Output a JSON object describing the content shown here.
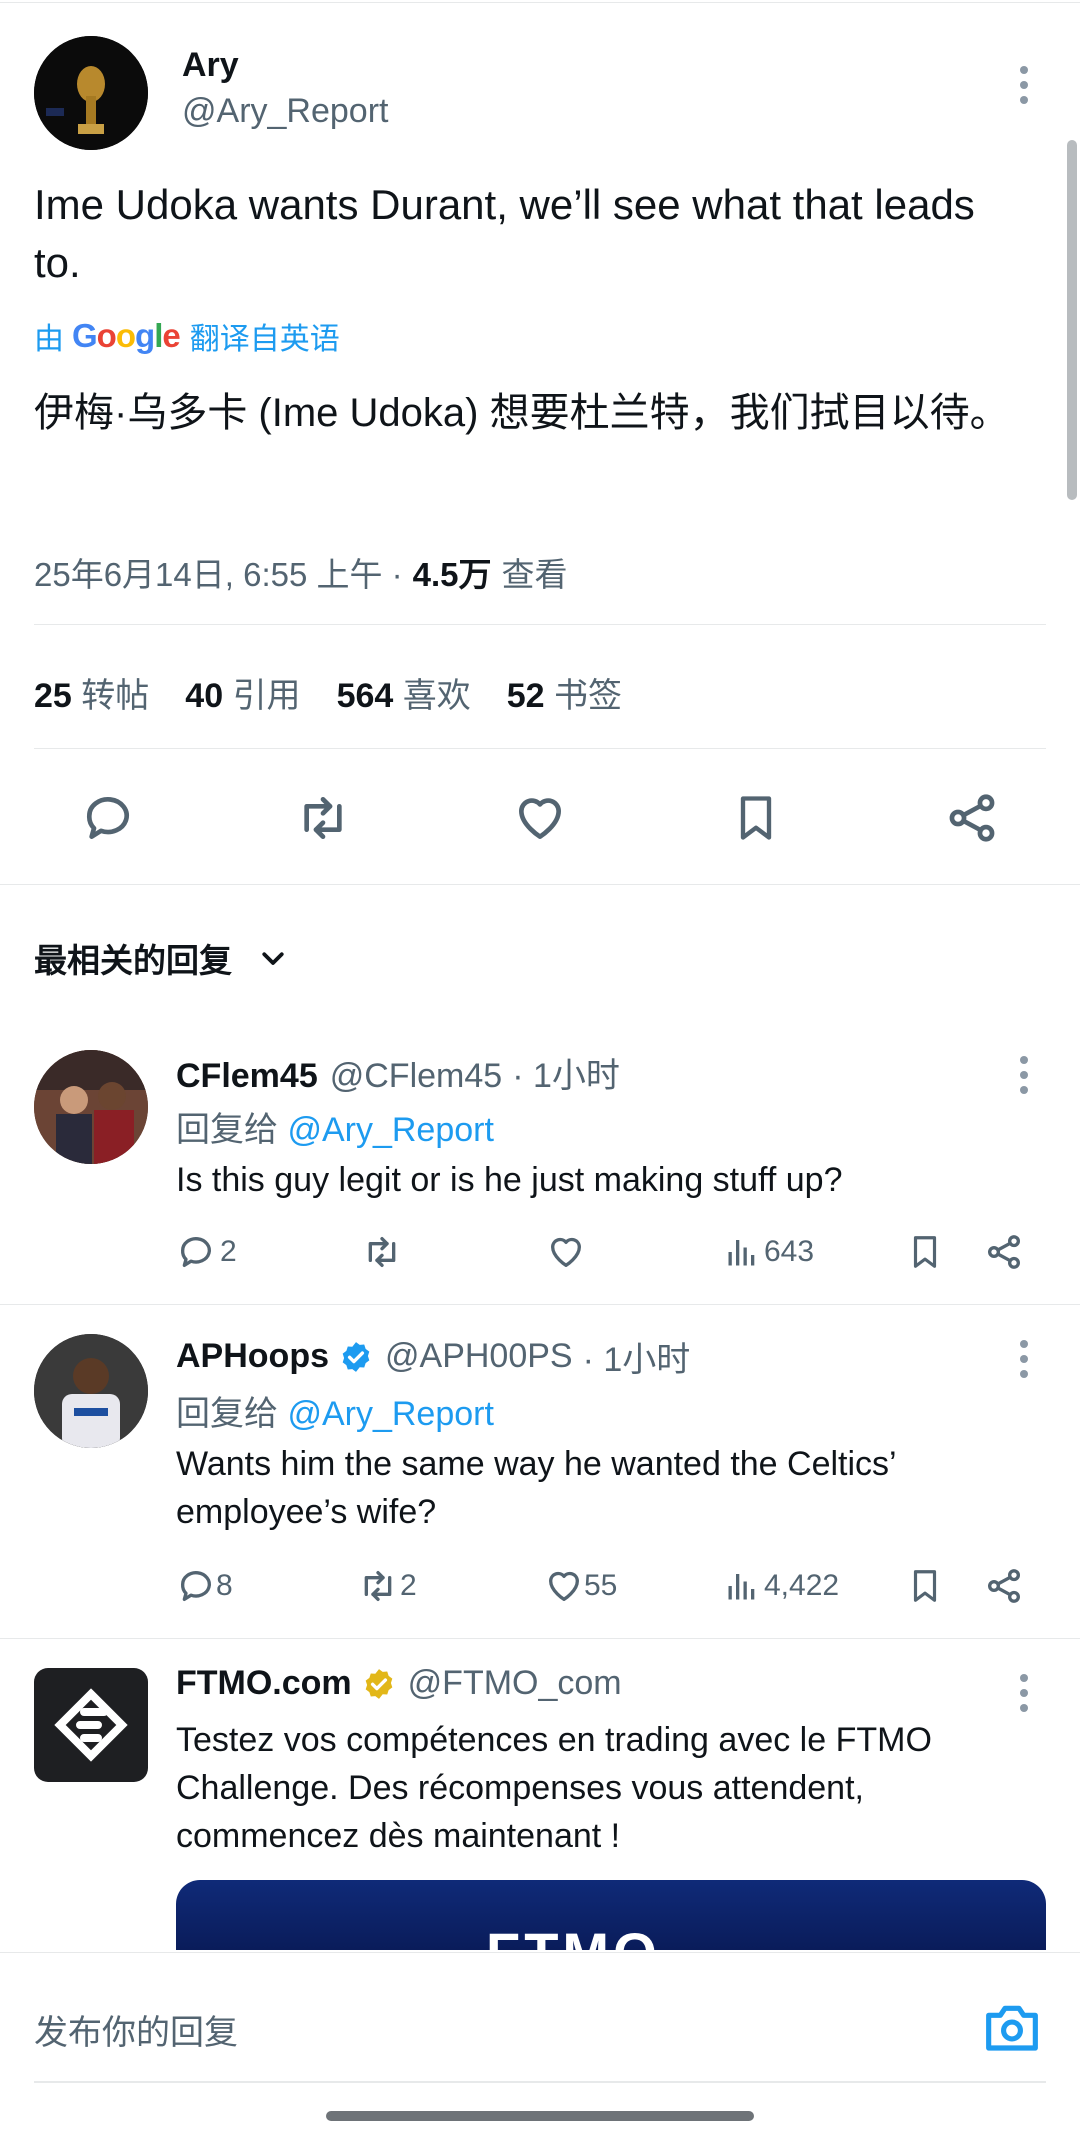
{
  "tweet": {
    "author_name": "Ary",
    "author_handle": "@Ary_Report",
    "text": "Ime Udoka wants Durant, we’ll see what that leads to.",
    "translate_prefix": "由",
    "translate_brand": "Google",
    "translate_suffix": "翻译自英语",
    "translation": "伊梅·乌多卡 (Ime Udoka) 想要杜兰特，我们拭目以待。",
    "timestamp": "25年6月14日, 6:55 上午 ·",
    "views_count": "4.5万",
    "views_label": "查看",
    "stats": [
      {
        "count": "25",
        "label": "转帖"
      },
      {
        "count": "40",
        "label": "引用"
      },
      {
        "count": "564",
        "label": "喜欢"
      },
      {
        "count": "52",
        "label": "书签"
      }
    ]
  },
  "replies_header": {
    "label": "最相关的回复"
  },
  "replies": [
    {
      "name": "CFlem45",
      "handle": "@CFlem45",
      "time": "· 1小时",
      "reply_to_prefix": "回复给",
      "reply_to": "@Ary_Report",
      "text": "Is this guy legit or is he just making stuff up?",
      "replies": "2",
      "retweets": "",
      "likes": "",
      "views": "643"
    },
    {
      "name": "APHoops",
      "handle": "@APH00PS",
      "time": "· 1小时",
      "reply_to_prefix": "回复给",
      "reply_to": "@Ary_Report",
      "text": "Wants him the same way he wanted the Celtics’ employee’s wife?",
      "replies": "8",
      "retweets": "2",
      "likes": "55",
      "views": "4,422"
    }
  ],
  "ad": {
    "name": "FTMO.com",
    "handle": "@FTMO_com",
    "text": "Testez vos compétences en trading avec le FTMO Challenge. Des récompenses vous attendent, commencez dès maintenant !",
    "banner_text": "FTMO"
  },
  "composer": {
    "placeholder": "发布你的回复"
  },
  "colors": {
    "accent": "#1d9bf0",
    "verified_gold": "#e2b719",
    "text": "#0f1419",
    "secondary": "#536471"
  }
}
